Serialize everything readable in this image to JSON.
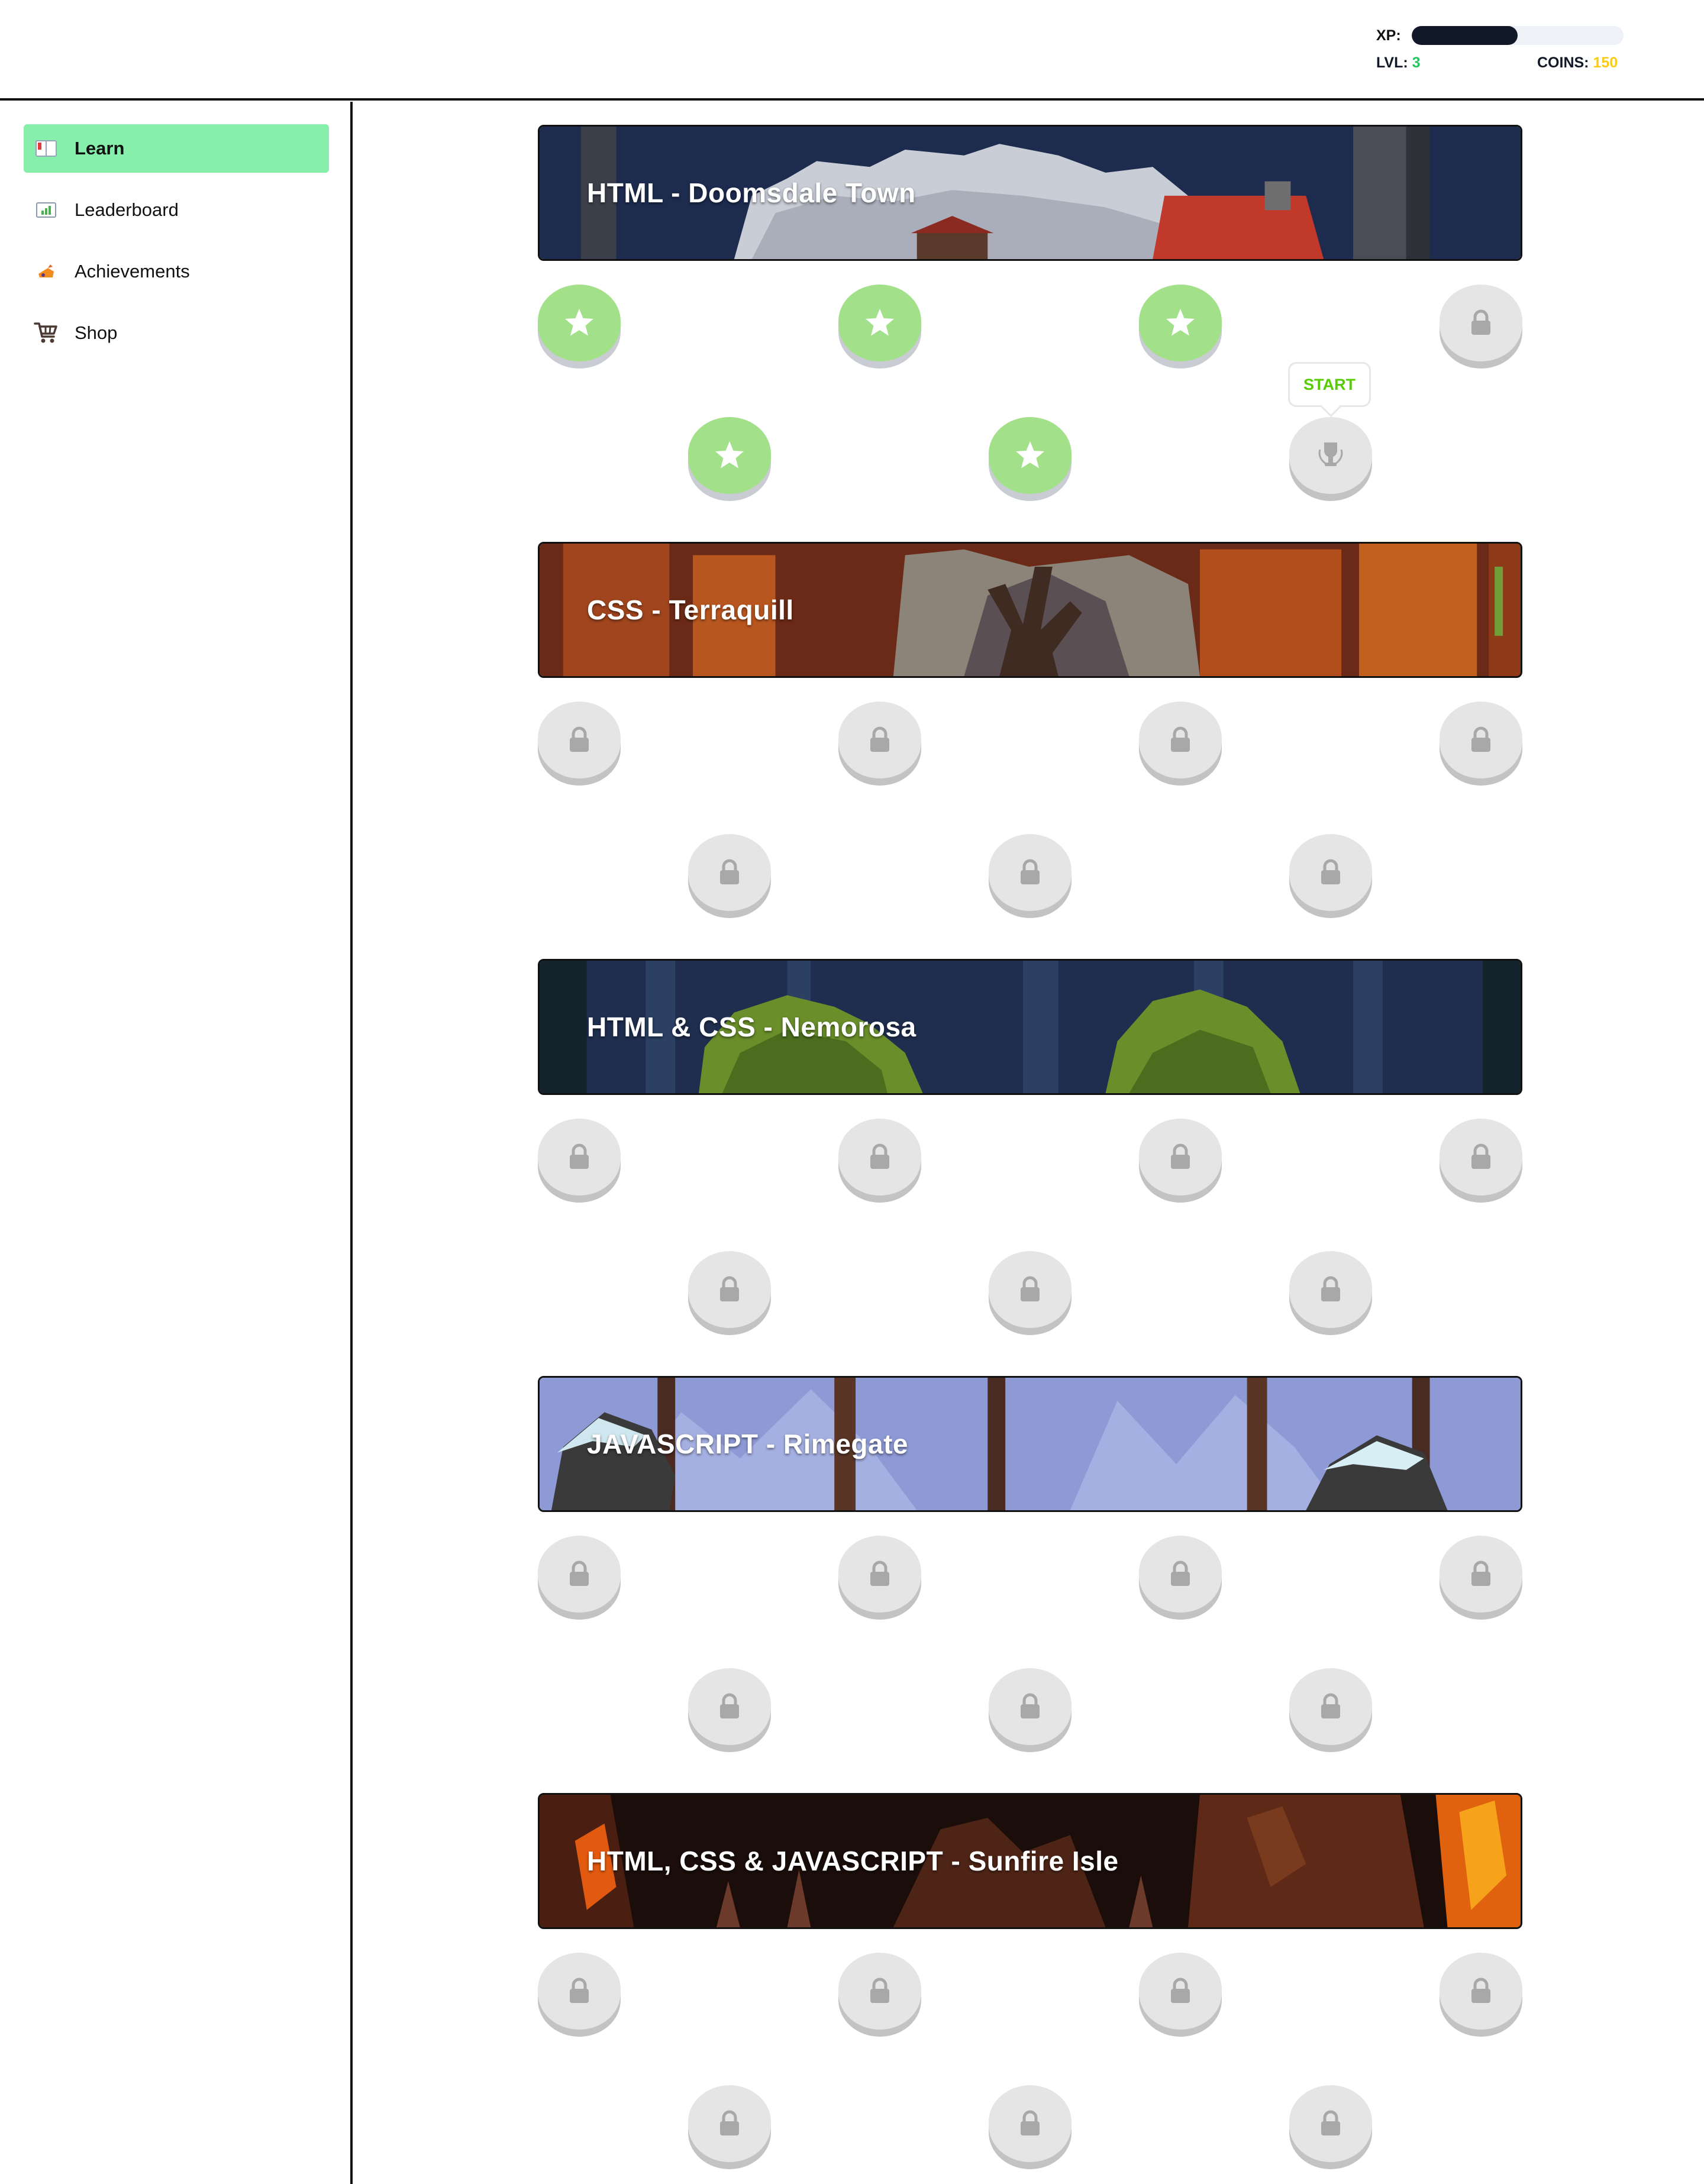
{
  "header": {
    "xp_label": "XP:",
    "xp_progress": 0.5,
    "xp_fill_color": "#111827",
    "lvl_label": "LVL:",
    "lvl_value": "3",
    "lvl_color": "#22c55e",
    "coins_label": "COINS:",
    "coins_value": "150",
    "coins_color": "#facc15"
  },
  "sidebar": {
    "items": [
      {
        "label": "Learn",
        "icon": "book-icon",
        "active": true
      },
      {
        "label": "Leaderboard",
        "icon": "chart-icon",
        "active": false
      },
      {
        "label": "Achievements",
        "icon": "trophy-icon",
        "active": false
      },
      {
        "label": "Shop",
        "icon": "cart-icon",
        "active": false
      }
    ],
    "active_color": "#86efac"
  },
  "sections": [
    {
      "title": "HTML - Doomsdale Town",
      "levels": [
        "done",
        "done",
        "done",
        "locked",
        "done",
        "done",
        "trophy"
      ]
    },
    {
      "title": "CSS - Terraquill",
      "levels": [
        "locked",
        "locked",
        "locked",
        "locked",
        "locked",
        "locked",
        "locked"
      ]
    },
    {
      "title": "HTML & CSS - Nemorosa",
      "levels": [
        "locked",
        "locked",
        "locked",
        "locked",
        "locked",
        "locked",
        "locked"
      ]
    },
    {
      "title": "JAVASCRIPT - Rimegate",
      "levels": [
        "locked",
        "locked",
        "locked",
        "locked",
        "locked",
        "locked",
        "locked"
      ]
    },
    {
      "title": "HTML, CSS & JAVASCRIPT - Sunfire Isle",
      "levels": [
        "locked",
        "locked",
        "locked",
        "locked",
        "locked",
        "locked",
        "locked"
      ]
    }
  ],
  "start_tooltip": "START",
  "colors": {
    "completed": "#a3e08a",
    "locked": "#e5e5e5",
    "start_text": "#58cc02"
  }
}
